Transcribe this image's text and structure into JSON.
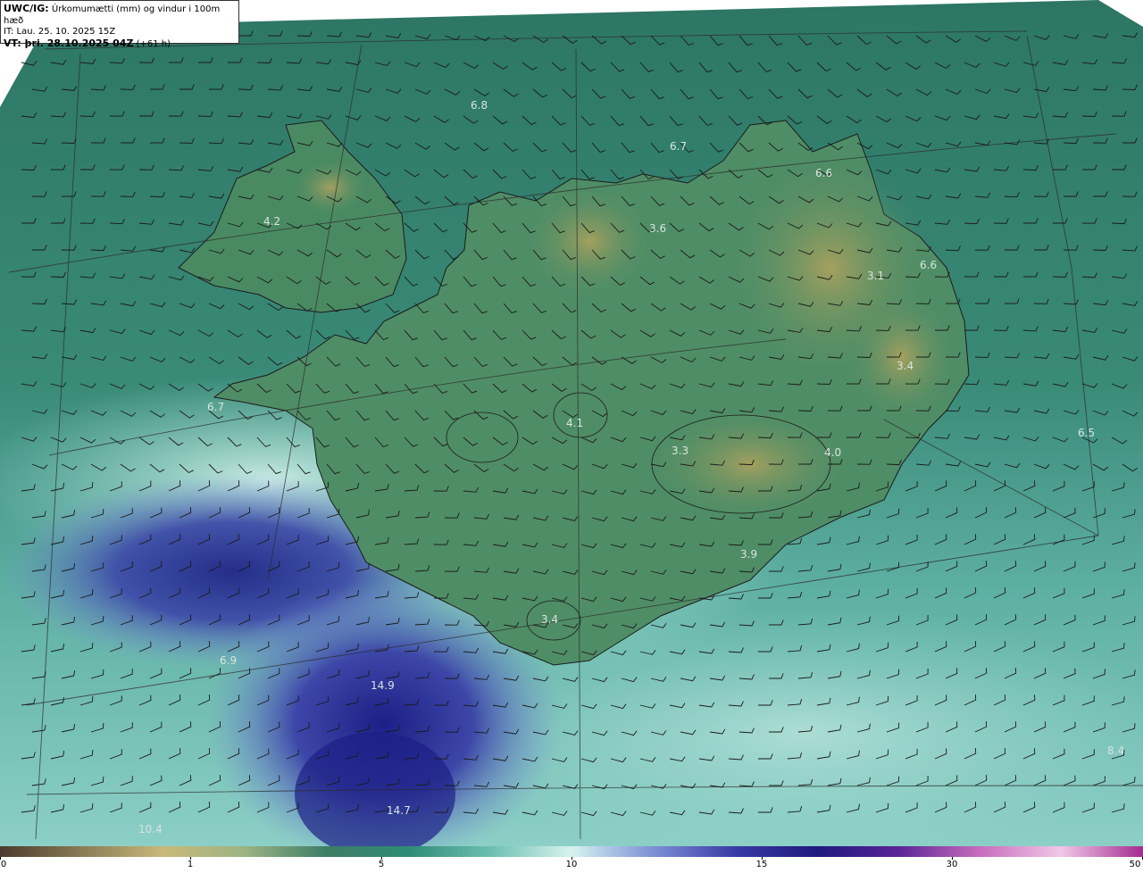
{
  "header": {
    "model_label": "UWC/IG:",
    "title": "Úrkomumætti (mm) og vindur i 100m hæð",
    "init_time": "IT: Lau. 25. 10. 2025 15Z",
    "valid_label": "VT: þri. 28.10.2025 04Z",
    "lead": "(+61 h)"
  },
  "value_labels": [
    "6.8",
    "6.7",
    "6.6",
    "4.2",
    "3.6",
    "6.6",
    "3.1",
    "3.4",
    "4.1",
    "3.3",
    "4.0",
    "6.5",
    "3.9",
    "3.4",
    "6.9",
    "14.9",
    "14.7",
    "10.4",
    "8.4",
    "6.7"
  ],
  "colorbar": {
    "ticks": [
      "0",
      "1",
      "5",
      "10",
      "15",
      "30",
      "50"
    ],
    "colors": [
      "#4b3b2e",
      "#8a7b55",
      "#c9b97a",
      "#9cb384",
      "#3d7d66",
      "#2f8b76",
      "#6cbfb0",
      "#d7f3ef",
      "#7d8fd6",
      "#3a3ba6",
      "#1e1a7e",
      "#5a2496",
      "#c86dbd",
      "#f1c7e8",
      "#a42b8f"
    ]
  },
  "colors": {
    "ocean": "#2f7a68",
    "land": "#4d8a62",
    "highland": "#8f9a55",
    "precip_light": "#b9e6e0",
    "precip_heavy": "#22258e"
  }
}
